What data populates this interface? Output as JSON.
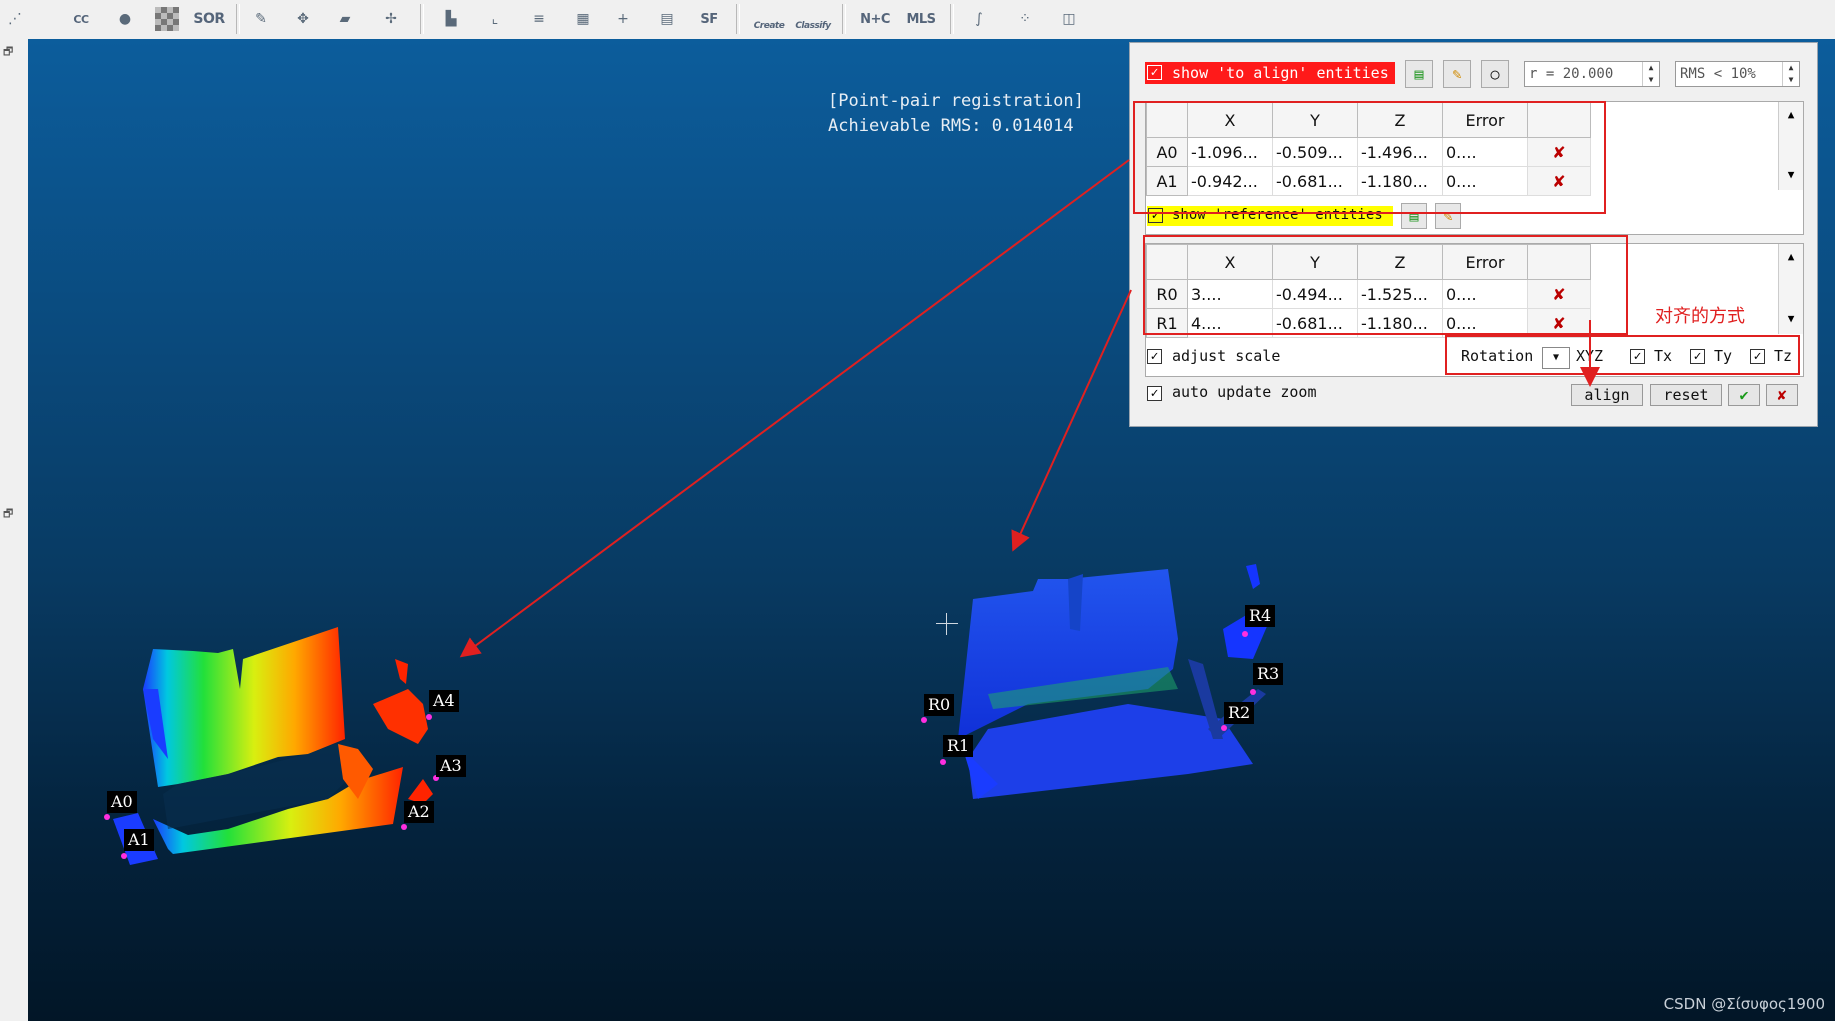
{
  "toolbar": {
    "items": [
      {
        "icon": "point-picking-icon"
      },
      {
        "icon": "cloud-compare-cc-icon"
      },
      {
        "icon": "cloud-fill-icon"
      },
      {
        "icon": "checker-icon"
      },
      {
        "icon": "sor-filter-icon",
        "label": "SOR"
      },
      {
        "icon": "brush-icon"
      },
      {
        "icon": "translate-rotate-icon"
      },
      {
        "icon": "plane-fit-icon"
      },
      {
        "icon": "pin-icon"
      },
      {
        "icon": "histogram-icon"
      },
      {
        "icon": "curve-icon"
      },
      {
        "icon": "min-max-icon"
      },
      {
        "icon": "grid-icon"
      },
      {
        "icon": "add-icon"
      },
      {
        "icon": "calculator-icon"
      },
      {
        "icon": "scalar-field-icon",
        "label": "SF"
      },
      {
        "icon": "canupo-create-icon",
        "label": "Create"
      },
      {
        "icon": "canupo-classify-icon",
        "label": "Classify"
      },
      {
        "icon": "normals-icon",
        "label": "N+C"
      },
      {
        "icon": "mls-icon",
        "label": "MLS"
      },
      {
        "icon": "segment-icon"
      },
      {
        "icon": "scatter-icon"
      },
      {
        "icon": "cube-icon"
      }
    ]
  },
  "viewport": {
    "info_line1": "[Point-pair registration]",
    "info_line2": "Achievable RMS: 0.014014",
    "watermark": "CSDN @Σίσυφος1900",
    "labels": {
      "A0": "A0",
      "A1": "A1",
      "A2": "A2",
      "A3": "A3",
      "A4": "A4",
      "R0": "R0",
      "R1": "R1",
      "R2": "R2",
      "R3": "R3",
      "R4": "R4"
    }
  },
  "dialog": {
    "show_align_label": "show 'to align' entities",
    "show_reference_label": "show 'reference' entities",
    "radius_value": "r = 20.000",
    "rms_value": "RMS < 10%",
    "columns": [
      "X",
      "Y",
      "Z",
      "Error"
    ],
    "align_rows": [
      {
        "id": "A0",
        "x": "-1.096...",
        "y": "-0.509...",
        "z": "-1.496...",
        "err": "0...."
      },
      {
        "id": "A1",
        "x": "-0.942...",
        "y": "-0.681...",
        "z": "-1.180...",
        "err": "0...."
      }
    ],
    "ref_rows": [
      {
        "id": "R0",
        "x": "3....",
        "y": "-0.494...",
        "z": "-1.525...",
        "err": "0...."
      },
      {
        "id": "R1",
        "x": "4....",
        "y": "-0.681...",
        "z": "-1.180...",
        "err": "0...."
      }
    ],
    "adjust_scale": "adjust scale",
    "auto_update_zoom": "auto update zoom",
    "rotation_label": "Rotation",
    "rotation_value": "XYZ",
    "tx": "Tx",
    "ty": "Ty",
    "tz": "Tz",
    "align_btn": "align",
    "reset_btn": "reset",
    "annotation": "对齐的方式"
  },
  "colors": {
    "highlight_red": "#ff1a1a",
    "highlight_yellow": "#ffff00",
    "annotation_red": "#e02020"
  }
}
